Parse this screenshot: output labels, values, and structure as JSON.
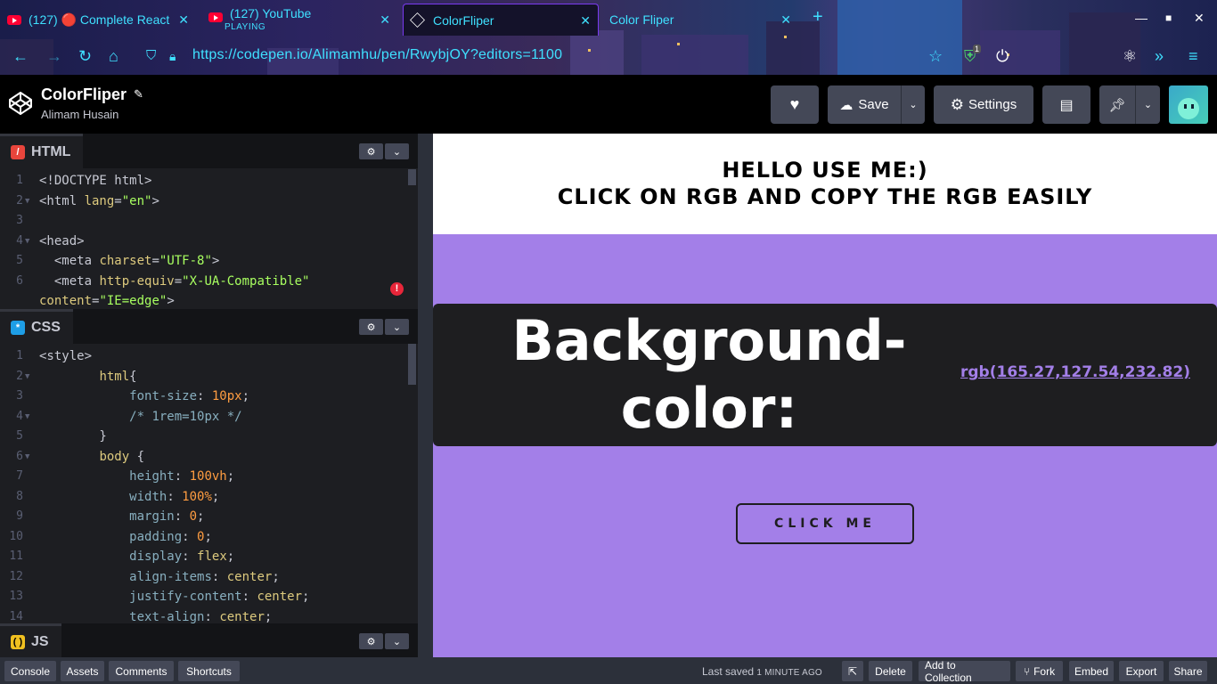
{
  "browser": {
    "tabs": [
      {
        "label": "(127) 🔴 Complete React",
        "icon": "youtube-icon"
      },
      {
        "label": "(127) YouTube",
        "sublabel": "PLAYING",
        "icon": "youtube-icon"
      },
      {
        "label": "ColorFliper",
        "icon": "codepen-icon",
        "active": true
      },
      {
        "label": "Color Fliper",
        "icon": "none"
      }
    ],
    "new_tab": "+",
    "url": "https://codepen.io/Alimamhu/pen/RwybjOY?editors=1100",
    "extension_badge": "1"
  },
  "pen": {
    "title": "ColorFliper",
    "author": "Alimam Husain"
  },
  "header_buttons": {
    "save": "Save",
    "settings": "Settings"
  },
  "editors": {
    "html": {
      "label": "HTML"
    },
    "css": {
      "label": "CSS"
    },
    "js": {
      "label": "JS"
    }
  },
  "html_lines": [
    {
      "n": "1",
      "fold": "",
      "parts": [
        [
          "tag",
          "<!DOCTYPE html>"
        ]
      ]
    },
    {
      "n": "2",
      "fold": "▼",
      "parts": [
        [
          "tag",
          "<html "
        ],
        [
          "attr",
          "lang"
        ],
        [
          "tag",
          "="
        ],
        [
          "str",
          "\"en\""
        ],
        [
          "tag",
          ">"
        ]
      ]
    },
    {
      "n": "3",
      "fold": "",
      "parts": []
    },
    {
      "n": "4",
      "fold": "▼",
      "parts": [
        [
          "tag",
          "<head>"
        ]
      ]
    },
    {
      "n": "5",
      "fold": "",
      "parts": [
        [
          "tag",
          "  <meta "
        ],
        [
          "attr",
          "charset"
        ],
        [
          "tag",
          "="
        ],
        [
          "str",
          "\"UTF-8\""
        ],
        [
          "tag",
          ">"
        ]
      ]
    },
    {
      "n": "6",
      "fold": "",
      "parts": [
        [
          "tag",
          "  <meta "
        ],
        [
          "attr",
          "http-equiv"
        ],
        [
          "tag",
          "="
        ],
        [
          "str",
          "\"X-UA-Compatible\""
        ]
      ]
    },
    {
      "n": "",
      "fold": "",
      "parts": [
        [
          "attr",
          "content"
        ],
        [
          "tag",
          "="
        ],
        [
          "str",
          "\"IE=edge\""
        ],
        [
          "tag",
          ">"
        ]
      ]
    }
  ],
  "css_lines": [
    {
      "n": "1",
      "fold": "",
      "parts": [
        [
          "tag",
          "<style>"
        ]
      ]
    },
    {
      "n": "2",
      "fold": "▼",
      "parts": [
        [
          "tag",
          "        "
        ],
        [
          "kw",
          "html"
        ],
        [
          "tag",
          "{"
        ]
      ]
    },
    {
      "n": "3",
      "fold": "",
      "parts": [
        [
          "tag",
          "            "
        ],
        [
          "cm",
          "font-size"
        ],
        [
          "tag",
          ": "
        ],
        [
          "num",
          "10px"
        ],
        [
          "tag",
          ";"
        ]
      ]
    },
    {
      "n": "4",
      "fold": "▼",
      "parts": [
        [
          "tag",
          "            "
        ],
        [
          "cm",
          "/* 1rem=10px */"
        ]
      ]
    },
    {
      "n": "5",
      "fold": "",
      "parts": [
        [
          "tag",
          "        }"
        ]
      ]
    },
    {
      "n": "6",
      "fold": "▼",
      "parts": [
        [
          "tag",
          "        "
        ],
        [
          "kw",
          "body"
        ],
        [
          "tag",
          " {"
        ]
      ]
    },
    {
      "n": "7",
      "fold": "",
      "parts": [
        [
          "tag",
          "            "
        ],
        [
          "cm",
          "height"
        ],
        [
          "tag",
          ": "
        ],
        [
          "num",
          "100vh"
        ],
        [
          "tag",
          ";"
        ]
      ]
    },
    {
      "n": "8",
      "fold": "",
      "parts": [
        [
          "tag",
          "            "
        ],
        [
          "cm",
          "width"
        ],
        [
          "tag",
          ": "
        ],
        [
          "num",
          "100%"
        ],
        [
          "tag",
          ";"
        ]
      ]
    },
    {
      "n": "9",
      "fold": "",
      "parts": [
        [
          "tag",
          "            "
        ],
        [
          "cm",
          "margin"
        ],
        [
          "tag",
          ": "
        ],
        [
          "num",
          "0"
        ],
        [
          "tag",
          ";"
        ]
      ]
    },
    {
      "n": "10",
      "fold": "",
      "parts": [
        [
          "tag",
          "            "
        ],
        [
          "cm",
          "padding"
        ],
        [
          "tag",
          ": "
        ],
        [
          "num",
          "0"
        ],
        [
          "tag",
          ";"
        ]
      ]
    },
    {
      "n": "11",
      "fold": "",
      "parts": [
        [
          "tag",
          "            "
        ],
        [
          "cm",
          "display"
        ],
        [
          "tag",
          ": "
        ],
        [
          "kw",
          "flex"
        ],
        [
          "tag",
          ";"
        ]
      ]
    },
    {
      "n": "12",
      "fold": "",
      "parts": [
        [
          "tag",
          "            "
        ],
        [
          "cm",
          "align-items"
        ],
        [
          "tag",
          ": "
        ],
        [
          "kw",
          "center"
        ],
        [
          "tag",
          ";"
        ]
      ]
    },
    {
      "n": "13",
      "fold": "",
      "parts": [
        [
          "tag",
          "            "
        ],
        [
          "cm",
          "justify-content"
        ],
        [
          "tag",
          ": "
        ],
        [
          "kw",
          "center"
        ],
        [
          "tag",
          ";"
        ]
      ]
    },
    {
      "n": "14",
      "fold": "",
      "parts": [
        [
          "tag",
          "            "
        ],
        [
          "cm",
          "text-align"
        ],
        [
          "tag",
          ": "
        ],
        [
          "kw",
          "center"
        ],
        [
          "tag",
          ";"
        ]
      ]
    }
  ],
  "preview": {
    "heading_line1": "HELLO USE ME:)",
    "heading_line2": "CLICK ON RGB AND COPY THE RGB EASILY",
    "big_text": "Background-color:",
    "rgb_value": "rgb(165.27,127.54,232.82)",
    "button": "CLICK ME",
    "background_color": "#a37fe8"
  },
  "footer": {
    "left_buttons": [
      "Console",
      "Assets",
      "Comments",
      "Shortcuts"
    ],
    "last_saved_prefix": "Last saved",
    "last_saved_ago": "1 MINUTE AGO",
    "right_buttons": [
      "Delete",
      "Add to Collection",
      "Fork",
      "Embed",
      "Export",
      "Share"
    ]
  }
}
